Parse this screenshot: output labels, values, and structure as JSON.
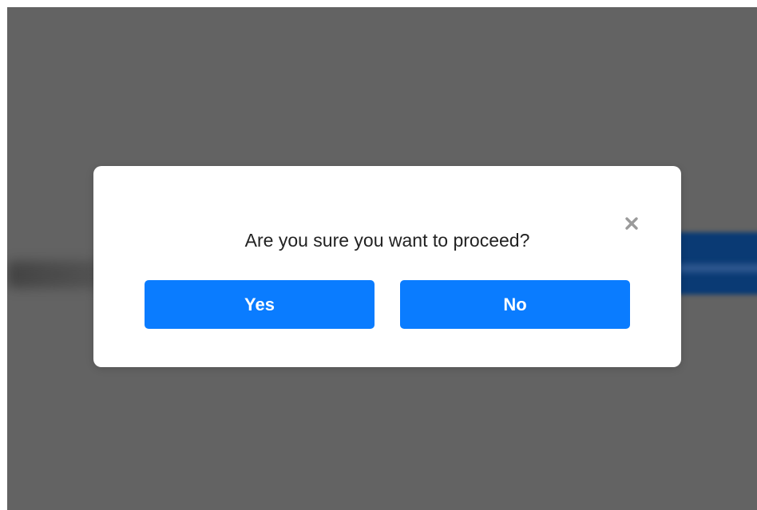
{
  "dialog": {
    "message": "Are you sure you want to proceed?",
    "close_icon": "close-icon",
    "yes_label": "Yes",
    "no_label": "No"
  },
  "colors": {
    "overlay": "#636363",
    "modal_background": "#ffffff",
    "button_primary": "#0a7cff",
    "button_text": "#ffffff",
    "message_text": "#222222",
    "close_icon": "#9a9a9a"
  }
}
